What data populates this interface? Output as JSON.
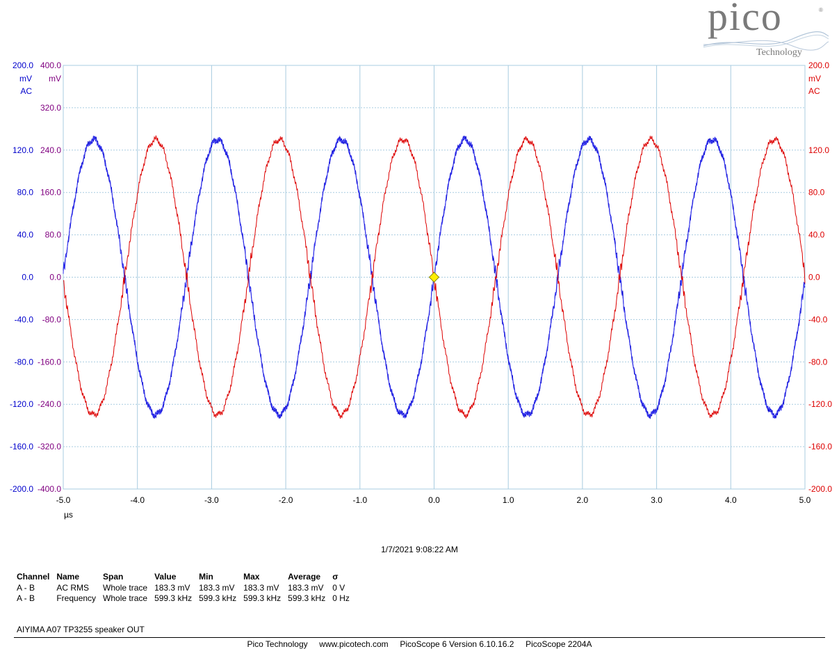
{
  "logo": {
    "brand": "pico",
    "registered": "®",
    "subtitle": "Technology"
  },
  "timestamp": "1/7/2021 9:08:22 AM",
  "measurements": {
    "headers": [
      "Channel",
      "Name",
      "Span",
      "Value",
      "Min",
      "Max",
      "Average",
      "σ"
    ],
    "rows": [
      [
        "A - B",
        "AC RMS",
        "Whole trace",
        "183.3 mV",
        "183.3 mV",
        "183.3 mV",
        "183.3 mV",
        "0 V"
      ],
      [
        "A - B",
        "Frequency",
        "Whole trace",
        "599.3 kHz",
        "599.3 kHz",
        "599.3 kHz",
        "599.3 kHz",
        "0 Hz"
      ]
    ]
  },
  "note": "AIYIMA A07 TP3255 speaker OUT",
  "footer": "Pico Technology     www.picotech.com     PicoScope 6 Version 6.10.16.2     PicoScope 2204A",
  "chart_data": {
    "type": "line",
    "xlim": [
      -5.0,
      5.0
    ],
    "xunit": "µs",
    "xticks": [
      "-5.0",
      "-4.0",
      "-3.0",
      "-2.0",
      "-1.0",
      "0.0",
      "1.0",
      "2.0",
      "3.0",
      "4.0",
      "5.0"
    ],
    "grid": true,
    "axes": {
      "left_outer": {
        "unit": "mV",
        "coupling": "AC",
        "ylim": [
          -200,
          200
        ],
        "color": "#0000cc",
        "ticks": [
          "200.0",
          "",
          "120.0",
          "80.0",
          "40.0",
          "0.0",
          "-40.0",
          "-80.0",
          "-120.0",
          "-160.0",
          "-200.0"
        ]
      },
      "left_inner": {
        "unit": "mV",
        "ylim": [
          -400,
          400
        ],
        "color": "#800080",
        "ticks": [
          "400.0",
          "320.0",
          "240.0",
          "160.0",
          "80.0",
          "0.0",
          "-80.0",
          "-160.0",
          "-240.0",
          "-320.0",
          "-400.0"
        ]
      },
      "right": {
        "unit": "mV",
        "coupling": "AC",
        "ylim": [
          -200,
          200
        ],
        "color": "#dd0000",
        "ticks": [
          "200.0",
          "",
          "120.0",
          "80.0",
          "40.0",
          "0.0",
          "-40.0",
          "-80.0",
          "-120.0",
          "-160.0",
          "-200.0"
        ]
      }
    },
    "series": [
      {
        "color": "#0000cc",
        "axis": "left_outer",
        "frequency_mhz": 0.5993,
        "amplitude_mv": 130,
        "phase": "rising zero crossing at 0.0 µs"
      },
      {
        "color": "#3333ee",
        "axis": "left_inner",
        "frequency_mhz": 0.5993,
        "amplitude_mv": 260,
        "phase": "rising zero crossing at 0.0 µs"
      },
      {
        "color": "#dd0000",
        "axis": "right",
        "frequency_mhz": 0.5993,
        "amplitude_mv": 130,
        "phase": "falling zero crossing at 0.0 µs"
      }
    ],
    "trigger": {
      "x": 0.0,
      "y": 0.0,
      "color": "#ffee00"
    }
  }
}
